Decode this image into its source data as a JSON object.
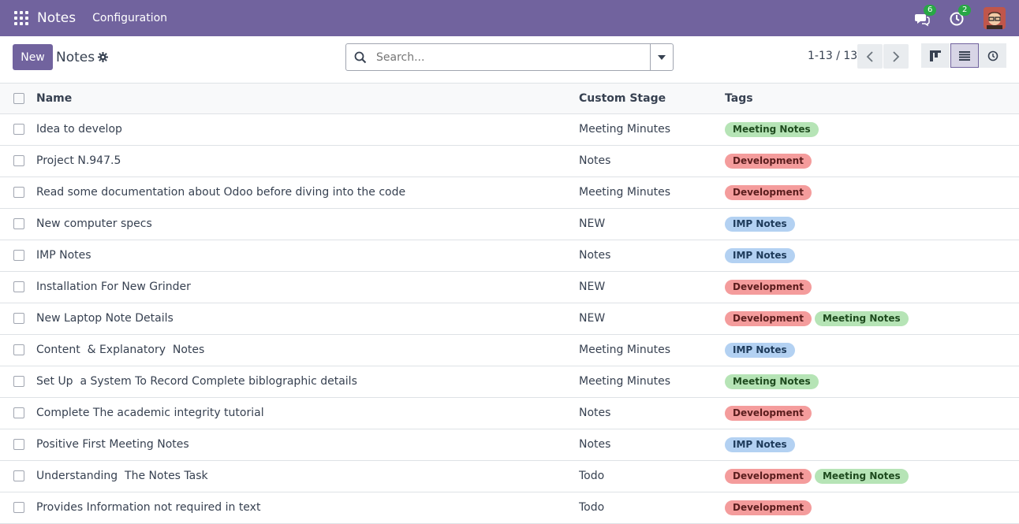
{
  "navbar": {
    "app_name": "Notes",
    "menu_configuration": "Configuration",
    "messages_count": "6",
    "activities_count": "2"
  },
  "control_panel": {
    "new_label": "New",
    "title": "Notes",
    "search_placeholder": "Search...",
    "pager": "1-13 / 13"
  },
  "table": {
    "headers": {
      "name": "Name",
      "stage": "Custom Stage",
      "tags": "Tags"
    },
    "rows": [
      {
        "name": "Idea to develop",
        "stage": "Meeting Minutes",
        "tags": [
          {
            "label": "Meeting Notes",
            "type": "meet"
          }
        ]
      },
      {
        "name": "Project N.947.5",
        "stage": "Notes",
        "tags": [
          {
            "label": "Development",
            "type": "dev"
          }
        ]
      },
      {
        "name": "Read some documentation about Odoo before diving into the code",
        "stage": "Meeting Minutes",
        "tags": [
          {
            "label": "Development",
            "type": "dev"
          }
        ]
      },
      {
        "name": "New computer specs",
        "stage": "NEW",
        "tags": [
          {
            "label": "IMP Notes",
            "type": "imp"
          }
        ]
      },
      {
        "name": "IMP Notes",
        "stage": "Notes",
        "tags": [
          {
            "label": "IMP Notes",
            "type": "imp"
          }
        ]
      },
      {
        "name": "Installation For New Grinder",
        "stage": "NEW",
        "tags": [
          {
            "label": "Development",
            "type": "dev"
          }
        ]
      },
      {
        "name": "New Laptop Note Details",
        "stage": "NEW",
        "tags": [
          {
            "label": "Development",
            "type": "dev"
          },
          {
            "label": "Meeting Notes",
            "type": "meet"
          }
        ]
      },
      {
        "name": "Content  & Explanatory  Notes",
        "stage": "Meeting Minutes",
        "tags": [
          {
            "label": "IMP Notes",
            "type": "imp"
          }
        ]
      },
      {
        "name": "Set Up  a System To Record Complete biblographic details",
        "stage": "Meeting Minutes",
        "tags": [
          {
            "label": "Meeting Notes",
            "type": "meet"
          }
        ]
      },
      {
        "name": "Complete The academic integrity tutorial",
        "stage": "Notes",
        "tags": [
          {
            "label": "Development",
            "type": "dev"
          }
        ]
      },
      {
        "name": "Positive First Meeting Notes",
        "stage": "Notes",
        "tags": [
          {
            "label": "IMP Notes",
            "type": "imp"
          }
        ]
      },
      {
        "name": "Understanding  The Notes Task",
        "stage": "Todo",
        "tags": [
          {
            "label": "Development",
            "type": "dev"
          },
          {
            "label": "Meeting Notes",
            "type": "meet"
          }
        ]
      },
      {
        "name": "Provides Information not required in text",
        "stage": "Todo",
        "tags": [
          {
            "label": "Development",
            "type": "dev"
          }
        ]
      }
    ]
  },
  "colors": {
    "brand": "#71639e",
    "tag_development": "#f49c9c",
    "tag_meeting_notes": "#b6e4b6",
    "tag_imp_notes": "#b3d1f2",
    "badge": "#28a745"
  },
  "icons": [
    "apps-grid-icon",
    "chat-icon",
    "clock-icon",
    "gear-icon",
    "search-icon",
    "caret-down-icon",
    "chevron-left-icon",
    "chevron-right-icon",
    "kanban-view-icon",
    "list-view-icon",
    "activity-view-icon"
  ]
}
